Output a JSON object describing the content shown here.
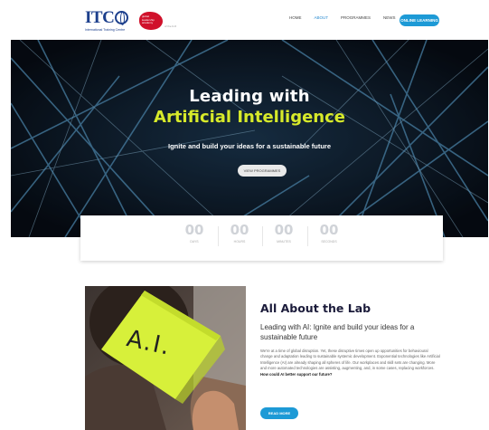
{
  "header": {
    "logo_text": "ITC",
    "logo_sub": "International Training Centre",
    "partner_text": "global leadership academy",
    "partner_side": "of the ILO",
    "nav": [
      "HOME",
      "ABOUT",
      "PROGRAMMES",
      "NEWS",
      "STORIES"
    ],
    "nav_active_index": 1,
    "cta_label": "ONLINE LEARNING"
  },
  "hero": {
    "title_line1": "Leading with",
    "title_line2": "Artificial Intelligence",
    "subtitle": "Ignite and build your ideas for a sustainable future",
    "button_label": "VIEW PROGRAMMES",
    "accent_color": "#d7ea2a"
  },
  "countdown": {
    "units": [
      {
        "value": "00",
        "label": "DAYS"
      },
      {
        "value": "00",
        "label": "HOURS"
      },
      {
        "value": "00",
        "label": "MINUTES"
      },
      {
        "value": "00",
        "label": "SECONDS"
      }
    ]
  },
  "about": {
    "image_text": "A.I.",
    "title": "All About the Lab",
    "subtitle": "Leading with AI: Ignite and build your ideas for a sustainable future",
    "body": "We're at a time of global disruption. Yet, these disruptive times open up opportunities for behavioural change and adaptation leading to sustainable systemic development. Exponential technologies like Artificial Intelligence (AI) are already shaping all spheres of life. Our workplaces and skill sets are changing. More and more automated technologies are assisting, augmenting, and, in some cases, replacing workforces.",
    "body_bold": "How could AI better support our future?",
    "button_label": "READ MORE"
  },
  "colors": {
    "brand_blue": "#1c3f8c",
    "cta_blue": "#1d9ad6",
    "partner_red": "#d0112b"
  }
}
